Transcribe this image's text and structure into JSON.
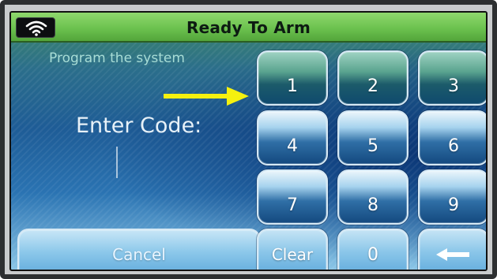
{
  "header": {
    "title": "Ready To Arm",
    "status_icon": "wifi-icon"
  },
  "prompt": {
    "subtitle": "Program the system",
    "enter_code_label": "Enter Code:",
    "code_value": ""
  },
  "keypad": {
    "keys": [
      "1",
      "2",
      "3",
      "4",
      "5",
      "6",
      "7",
      "8",
      "9",
      "Clear",
      "0"
    ],
    "backspace_icon": "backspace-arrow-icon"
  },
  "actions": {
    "cancel_label": "Cancel"
  },
  "annotation": {
    "arrow_color": "#f5f10f"
  }
}
